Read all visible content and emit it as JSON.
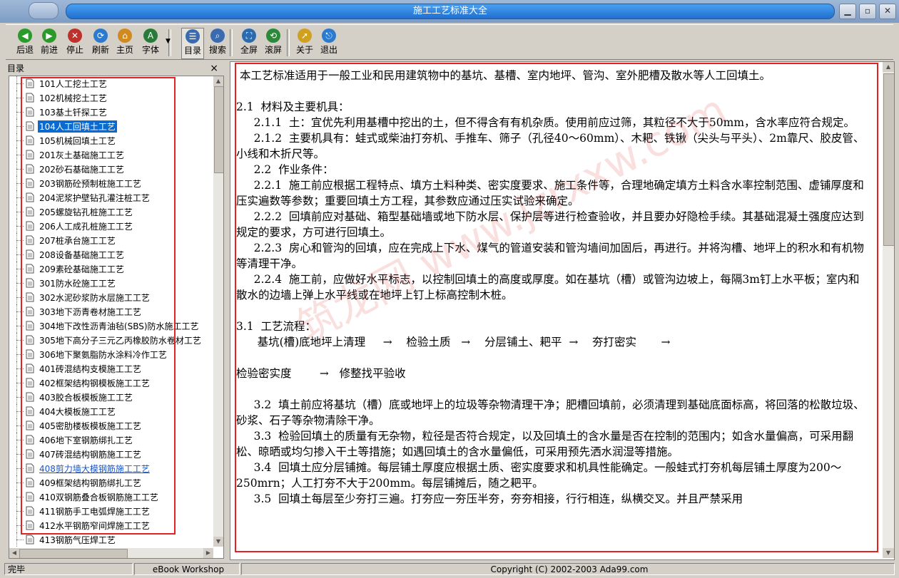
{
  "window": {
    "title": "施工工艺标准大全"
  },
  "toolbar": {
    "buttons": [
      {
        "id": "back",
        "label": "后退",
        "icon": "arrow-left-icon"
      },
      {
        "id": "forward",
        "label": "前进",
        "icon": "arrow-right-icon"
      },
      {
        "id": "stop",
        "label": "停止",
        "icon": "stop-icon"
      },
      {
        "id": "refresh",
        "label": "刷新",
        "icon": "refresh-icon"
      },
      {
        "id": "home",
        "label": "主页",
        "icon": "home-icon"
      },
      {
        "id": "font",
        "label": "字体",
        "icon": "font-icon"
      },
      {
        "id": "toc",
        "label": "目录",
        "icon": "toc-icon"
      },
      {
        "id": "search",
        "label": "搜索",
        "icon": "magnifier-icon"
      },
      {
        "id": "fullscreen",
        "label": "全屏",
        "icon": "fullscreen-icon"
      },
      {
        "id": "scroll",
        "label": "滚屏",
        "icon": "autoscroll-icon"
      },
      {
        "id": "about",
        "label": "关于",
        "icon": "pointer-icon"
      },
      {
        "id": "exit",
        "label": "退出",
        "icon": "exit-icon"
      }
    ]
  },
  "sidebar": {
    "title": "目录",
    "close": "×",
    "items": [
      "101人工挖土工艺",
      "102机械挖土工艺",
      "103基土钎探工艺",
      "104人工回填土工艺",
      "105机械回填土工艺",
      "201灰土基础施工工艺",
      "202砂石基础施工工艺",
      "203钢筋砼预制桩施工工艺",
      "204泥浆护壁钻孔灌注桩工艺",
      "205螺旋钻孔桩施工工艺",
      "206人工成孔桩施工工艺",
      "207桩承台施工工艺",
      "208设备基础施工工艺",
      "209素砼基础施工工艺",
      "301防水砼施工工艺",
      "302水泥砂浆防水层施工工艺",
      "303地下沥青卷材施工工艺",
      "304地下改性沥青油毡(SBS)防水施工工艺",
      "305地下高分子三元乙丙橡胶防水卷材工艺",
      "306地下聚氨脂防水涂料冷作工艺",
      "401砖混结构支模施工工艺",
      "402框架结构钢模板施工工艺",
      "403胶合板模板施工工艺",
      "404大模板施工工艺",
      "405密肋楼板模板施工工艺",
      "406地下室钢筋绑扎工艺",
      "407砖混结构钢筋施工工艺",
      "408剪力墙大模钢筋施工工艺",
      "409框架结构钢筋绑扎工艺",
      "410双钢筋叠合板钢筋施工工艺",
      "411钢筋手工电弧焊施工工艺",
      "412水平钢筋窄间焊施工工艺",
      "413钢筋气压焊工艺"
    ],
    "selected_index": 3,
    "visited_index": 27
  },
  "content": {
    "paragraphs": [
      " 本工艺标准适用于一般工业和民用建筑物中的基坑、基槽、室内地坪、管沟、室外肥槽及散水等人工回填土。",
      "",
      "2.1  材料及主要机具：",
      "     2.1.1  土：宜优先利用基槽中挖出的土，但不得含有有机杂质。使用前应过筛，其粒径不大于50mm，含水率应符合规定。",
      "     2.1.2  主要机具有：蛙式或柴油打夯机、手推车、筛子（孔径40～60mm）、木耙、铁锹（尖头与平头）、2m靠尺、胶皮管、小线和木折尺等。",
      "     2.2  作业条件：",
      "     2.2.1  施工前应根据工程特点、填方土料种类、密实度要求、施工条件等，合理地确定填方土料含水率控制范围、虚铺厚度和压实遍数等参数；重要回填土方工程，其参数应通过压实试验来确定。",
      "     2.2.2  回填前应对基础、箱型基础墙或地下防水层、保护层等进行检查验收，并且要办好隐检手续。其基础混凝土强度应达到规定的要求，方可进行回填土。",
      "     2.2.3  房心和管沟的回填，应在完成上下水、煤气的管道安装和管沟墙间加固后，再进行。并将沟槽、地坪上的积水和有机物等清理干净。",
      "     2.2.4  施工前，应做好水平标志，以控制回填土的高度或厚度。如在基坑（槽）或管沟边坡上，每隔3m钉上水平板；室内和散水的边墙上弹上水平线或在地坪上钉上标高控制木桩。",
      "",
      "3.1  工艺流程：",
      "      基坑(槽)底地坪上清理     →    检验土质   →    分层铺土、耙平  →    夯打密实       →",
      "",
      "检验密实度        →   修整找平验收",
      "",
      "     3.2  填土前应将基坑（槽）底或地坪上的垃圾等杂物清理干净；肥槽回填前，必须清理到基础底面标高，将回落的松散垃圾、砂浆、石子等杂物清除干净。",
      "     3.3  检验回填土的质量有无杂物，粒径是否符合规定，以及回填土的含水量是否在控制的范围内；如含水量偏高，可采用翻松、晾晒或均匀掺入干土等措施；如遇回填土的含水量偏低，可采用预先洒水润湿等措施。",
      "     3.4  回填土应分层铺摊。每层铺土厚度应根据土质、密实度要求和机具性能确定。一般蛙式打夯机每层铺土厚度为200～250mrn；人工打夯不大于200mm。每层铺摊后，随之耙平。",
      "     3.5  回填土每层至少夯打三遍。打夯应一夯压半夯，夯夯相接，行行相连，纵横交叉。并且严禁采用"
    ],
    "watermark": "筑龙网 www.jzrxxw.com"
  },
  "statusbar": {
    "left": "完毕",
    "middle": "eBook Workshop",
    "right": "Copyright (C) 2002-2003 Ada99.com"
  }
}
